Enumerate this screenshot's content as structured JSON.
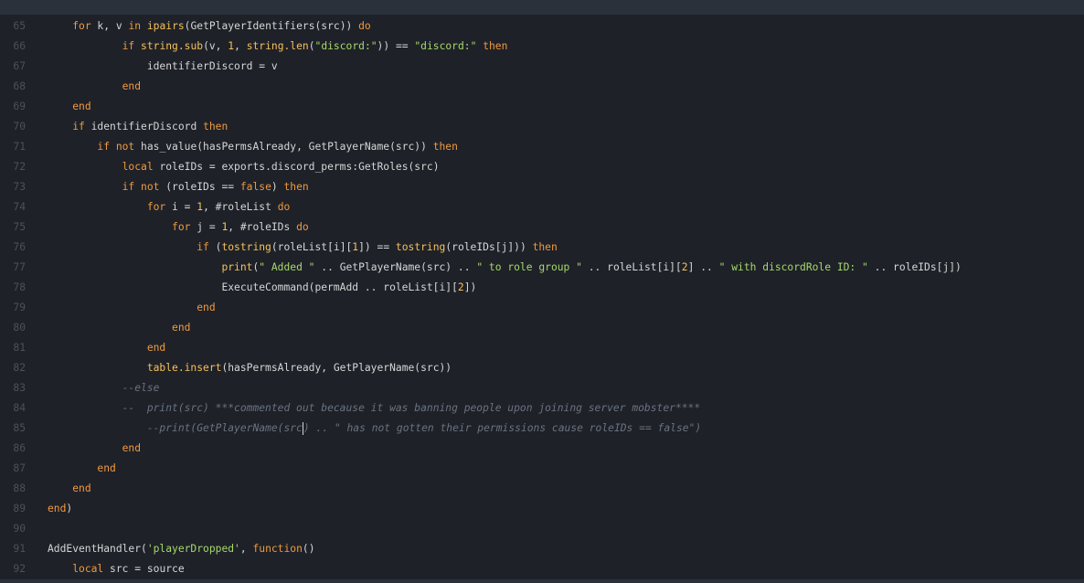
{
  "colors": {
    "background": "#1e2128",
    "bar": "#2b313b",
    "line_number": "#4b515b",
    "keyword": "#f19a3e",
    "function": "#f6c15b",
    "string": "#a6d96a",
    "comment": "#6b7380",
    "text": "#d6d6d6"
  },
  "lines": [
    {
      "n": "65",
      "indent": 4,
      "tokens": [
        [
          "kw",
          "for"
        ],
        [
          "p",
          " k, v "
        ],
        [
          "kw",
          "in"
        ],
        [
          "p",
          " "
        ],
        [
          "fn",
          "ipairs"
        ],
        [
          "p",
          "(GetPlayerIdentifiers(src)) "
        ],
        [
          "kw",
          "do"
        ]
      ]
    },
    {
      "n": "66",
      "indent": 12,
      "tokens": [
        [
          "kw",
          "if"
        ],
        [
          "p",
          " "
        ],
        [
          "fn",
          "string.sub"
        ],
        [
          "p",
          "(v, "
        ],
        [
          "num",
          "1"
        ],
        [
          "p",
          ", "
        ],
        [
          "fn",
          "string.len"
        ],
        [
          "p",
          "("
        ],
        [
          "str",
          "\"discord:\""
        ],
        [
          "p",
          ")) == "
        ],
        [
          "str",
          "\"discord:\""
        ],
        [
          "p",
          " "
        ],
        [
          "kw",
          "then"
        ]
      ]
    },
    {
      "n": "67",
      "indent": 16,
      "tokens": [
        [
          "p",
          "identifierDiscord = v"
        ]
      ]
    },
    {
      "n": "68",
      "indent": 12,
      "tokens": [
        [
          "kw",
          "end"
        ]
      ]
    },
    {
      "n": "69",
      "indent": 4,
      "tokens": [
        [
          "kw",
          "end"
        ]
      ]
    },
    {
      "n": "70",
      "indent": 4,
      "tokens": [
        [
          "kw",
          "if"
        ],
        [
          "p",
          " identifierDiscord "
        ],
        [
          "kw",
          "then"
        ]
      ]
    },
    {
      "n": "71",
      "indent": 8,
      "tokens": [
        [
          "kw",
          "if not"
        ],
        [
          "p",
          " has_value(hasPermsAlready, GetPlayerName(src)) "
        ],
        [
          "kw",
          "then"
        ]
      ]
    },
    {
      "n": "72",
      "indent": 12,
      "tokens": [
        [
          "kw",
          "local"
        ],
        [
          "p",
          " roleIDs = exports.discord_perms:GetRoles(src)"
        ]
      ]
    },
    {
      "n": "73",
      "indent": 12,
      "tokens": [
        [
          "kw",
          "if not"
        ],
        [
          "p",
          " (roleIDs == "
        ],
        [
          "kw",
          "false"
        ],
        [
          "p",
          ") "
        ],
        [
          "kw",
          "then"
        ]
      ]
    },
    {
      "n": "74",
      "indent": 16,
      "tokens": [
        [
          "kw",
          "for"
        ],
        [
          "p",
          " i = "
        ],
        [
          "num",
          "1"
        ],
        [
          "p",
          ", #roleList "
        ],
        [
          "kw",
          "do"
        ]
      ]
    },
    {
      "n": "75",
      "indent": 20,
      "tokens": [
        [
          "kw",
          "for"
        ],
        [
          "p",
          " j = "
        ],
        [
          "num",
          "1"
        ],
        [
          "p",
          ", #roleIDs "
        ],
        [
          "kw",
          "do"
        ]
      ]
    },
    {
      "n": "76",
      "indent": 24,
      "tokens": [
        [
          "kw",
          "if"
        ],
        [
          "p",
          " ("
        ],
        [
          "fn",
          "tostring"
        ],
        [
          "p",
          "(roleList[i]["
        ],
        [
          "num",
          "1"
        ],
        [
          "p",
          "]) == "
        ],
        [
          "fn",
          "tostring"
        ],
        [
          "p",
          "(roleIDs[j])) "
        ],
        [
          "kw",
          "then"
        ]
      ]
    },
    {
      "n": "77",
      "indent": 28,
      "tokens": [
        [
          "fn",
          "print"
        ],
        [
          "p",
          "("
        ],
        [
          "str",
          "\" Added \""
        ],
        [
          "p",
          " .. GetPlayerName(src) .. "
        ],
        [
          "str",
          "\" to role group \""
        ],
        [
          "p",
          " .. roleList[i]["
        ],
        [
          "num",
          "2"
        ],
        [
          "p",
          "] .. "
        ],
        [
          "str",
          "\" with discordRole ID: \""
        ],
        [
          "p",
          " .. roleIDs[j])"
        ]
      ]
    },
    {
      "n": "78",
      "indent": 28,
      "tokens": [
        [
          "p",
          "ExecuteCommand(permAdd .. roleList[i]["
        ],
        [
          "num",
          "2"
        ],
        [
          "p",
          "])"
        ]
      ]
    },
    {
      "n": "79",
      "indent": 24,
      "tokens": [
        [
          "kw",
          "end"
        ]
      ]
    },
    {
      "n": "80",
      "indent": 20,
      "tokens": [
        [
          "kw",
          "end"
        ]
      ]
    },
    {
      "n": "81",
      "indent": 16,
      "tokens": [
        [
          "kw",
          "end"
        ]
      ]
    },
    {
      "n": "82",
      "indent": 16,
      "tokens": [
        [
          "fn",
          "table.insert"
        ],
        [
          "p",
          "(hasPermsAlready, GetPlayerName(src))"
        ]
      ]
    },
    {
      "n": "83",
      "indent": 12,
      "tokens": [
        [
          "cm",
          "--else"
        ]
      ]
    },
    {
      "n": "84",
      "indent": 12,
      "tokens": [
        [
          "cm",
          "--  print(src) ***commented out because it was banning people upon joining server mobster****"
        ]
      ]
    },
    {
      "n": "85",
      "indent": 16,
      "tokens": [
        [
          "cm",
          "--print(GetPlayerName(src"
        ],
        [
          "cursor",
          ""
        ],
        [
          "cm",
          ") .. \" has not gotten their permissions cause roleIDs == false\")"
        ]
      ]
    },
    {
      "n": "86",
      "indent": 12,
      "tokens": [
        [
          "kw",
          "end"
        ]
      ]
    },
    {
      "n": "87",
      "indent": 8,
      "tokens": [
        [
          "kw",
          "end"
        ]
      ]
    },
    {
      "n": "88",
      "indent": 4,
      "tokens": [
        [
          "kw",
          "end"
        ]
      ]
    },
    {
      "n": "89",
      "indent": 0,
      "tokens": [
        [
          "kw",
          "end"
        ],
        [
          "p",
          ")"
        ]
      ]
    },
    {
      "n": "90",
      "indent": 0,
      "tokens": []
    },
    {
      "n": "91",
      "indent": 0,
      "tokens": [
        [
          "p",
          "AddEventHandler("
        ],
        [
          "str",
          "'playerDropped'"
        ],
        [
          "p",
          ", "
        ],
        [
          "kw",
          "function"
        ],
        [
          "p",
          "()"
        ]
      ]
    },
    {
      "n": "92",
      "indent": 4,
      "tokens": [
        [
          "kw",
          "local"
        ],
        [
          "p",
          " src = source"
        ]
      ]
    }
  ]
}
